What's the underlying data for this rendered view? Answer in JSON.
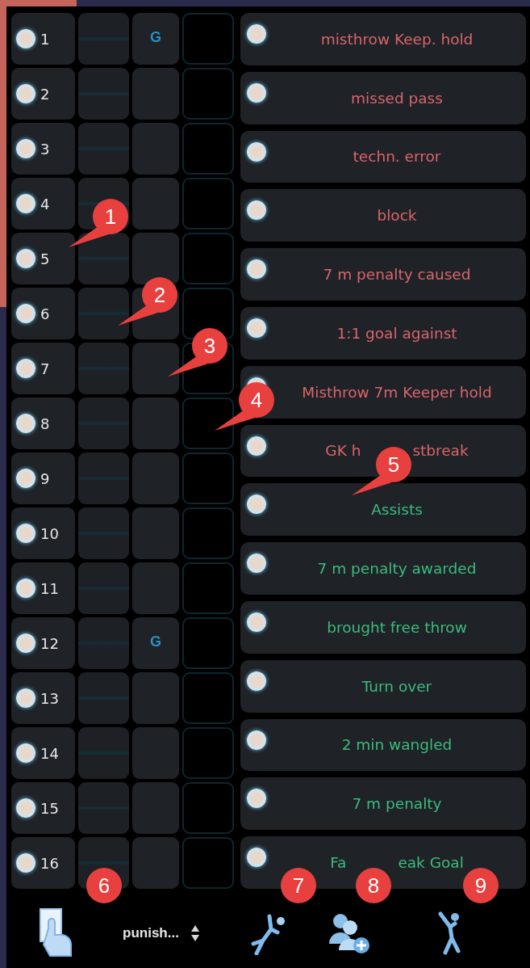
{
  "players": [
    {
      "number": "1",
      "selected": false,
      "mark": "G"
    },
    {
      "number": "2",
      "selected": false
    },
    {
      "number": "3",
      "selected": false
    },
    {
      "number": "4",
      "selected": false
    },
    {
      "number": "5",
      "selected": false
    },
    {
      "number": "6",
      "selected": false
    },
    {
      "number": "7",
      "selected": false
    },
    {
      "number": "8",
      "selected": false
    },
    {
      "number": "9",
      "selected": false
    },
    {
      "number": "10",
      "selected": false
    },
    {
      "number": "11",
      "selected": false
    },
    {
      "number": "12",
      "selected": false,
      "mark": "G"
    },
    {
      "number": "13",
      "selected": false
    },
    {
      "number": "14",
      "selected": false
    },
    {
      "number": "15",
      "selected": false
    },
    {
      "number": "16",
      "selected": false
    }
  ],
  "actions": [
    {
      "label": "misthrow Keep. hold",
      "selected": false,
      "kind": "negative"
    },
    {
      "label": "missed pass",
      "selected": false,
      "kind": "negative"
    },
    {
      "label": "techn. error",
      "selected": false,
      "kind": "negative"
    },
    {
      "label": "block",
      "selected": false,
      "kind": "negative"
    },
    {
      "label": "7 m penalty caused",
      "selected": false,
      "kind": "negative"
    },
    {
      "label": "1:1 goal against",
      "selected": false,
      "kind": "negative"
    },
    {
      "label": "Misthrow 7m Keeper hold",
      "selected": false,
      "kind": "negative"
    },
    {
      "label_parts": [
        "GK h",
        "stbreak"
      ],
      "selected": false,
      "kind": "negative"
    },
    {
      "label": "Assists",
      "selected": false,
      "kind": "positive"
    },
    {
      "label": "7 m penalty awarded",
      "selected": false,
      "kind": "positive"
    },
    {
      "label": "brought free throw",
      "selected": false,
      "kind": "positive"
    },
    {
      "label": "Turn over",
      "selected": false,
      "kind": "positive"
    },
    {
      "label": "2 min wangled",
      "selected": false,
      "kind": "positive"
    },
    {
      "label": "7 m penalty",
      "selected": false,
      "kind": "positive"
    },
    {
      "label_parts": [
        "Fa",
        "eak Goal"
      ],
      "selected": false,
      "kind": "positive"
    }
  ],
  "toolbar": {
    "dropdown": {
      "value": "punish..."
    }
  },
  "callouts": [
    {
      "number": "1",
      "kind": "pointer"
    },
    {
      "number": "2",
      "kind": "pointer"
    },
    {
      "number": "3",
      "kind": "pointer"
    },
    {
      "number": "4",
      "kind": "pointer"
    },
    {
      "number": "5",
      "kind": "pointer"
    },
    {
      "number": "6",
      "kind": "plain"
    },
    {
      "number": "7",
      "kind": "plain"
    },
    {
      "number": "8",
      "kind": "plain"
    },
    {
      "number": "9",
      "kind": "plain"
    }
  ]
}
